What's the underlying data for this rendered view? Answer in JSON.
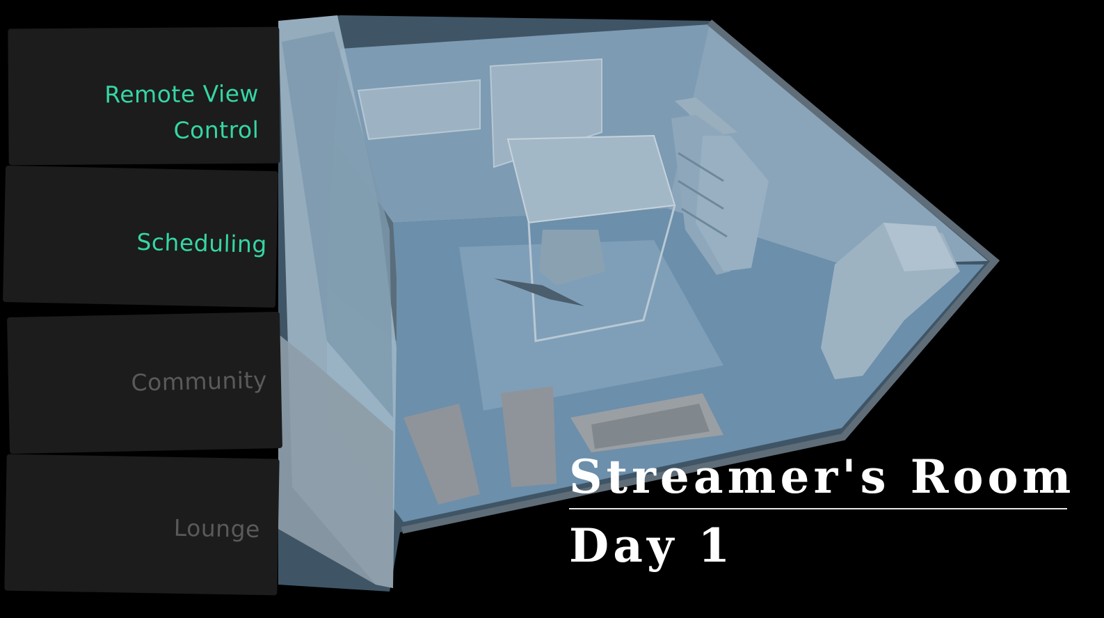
{
  "menu": {
    "items": [
      {
        "label": "Remote View\nControl",
        "state": "active"
      },
      {
        "label": "Scheduling",
        "state": "active"
      },
      {
        "label": "Community",
        "state": "disabled"
      },
      {
        "label": "Lounge",
        "state": "disabled"
      }
    ]
  },
  "location": {
    "title": "Streamer's Room",
    "day": "Day 1"
  },
  "colors": {
    "background": "#000000",
    "menu_card": "#1c1c1c",
    "menu_active_text": "#36d6a4",
    "menu_disabled_text": "#5a5a5a",
    "room_tint": "#7fa2bd",
    "title_text": "#ffffff"
  }
}
